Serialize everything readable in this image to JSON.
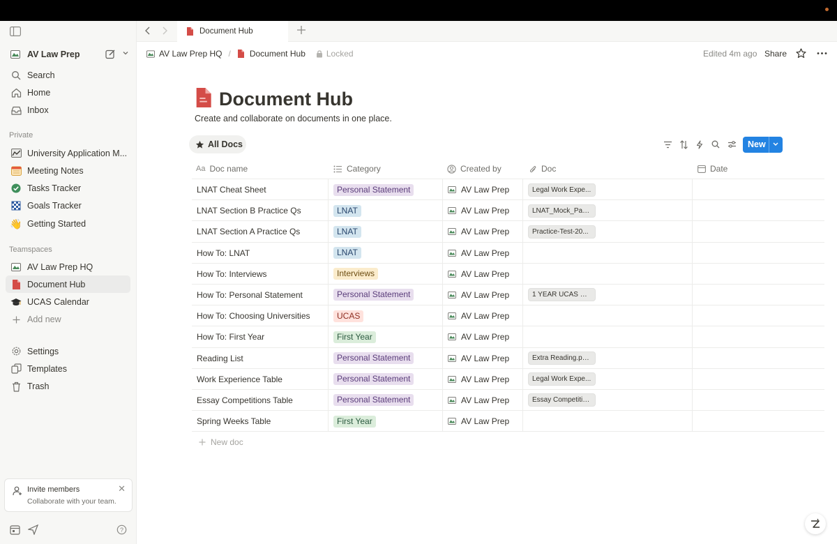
{
  "colors": {
    "accent": "#2383e2",
    "page_icon": "#d44c47",
    "tag_purple_bg": "#e8deee",
    "tag_purple_fg": "#5a3c7a",
    "tag_blue_bg": "#d3e5ef",
    "tag_blue_fg": "#28456c",
    "tag_yellow_bg": "#fbeccc",
    "tag_yellow_fg": "#6e4e14",
    "tag_red_bg": "#ffe2dd",
    "tag_red_fg": "#8e2f23",
    "tag_green_bg": "#dbeddb",
    "tag_green_fg": "#2b593f"
  },
  "sidebar": {
    "workspace": "AV Law Prep",
    "top": [
      {
        "label": "Search",
        "icon": "search-icon"
      },
      {
        "label": "Home",
        "icon": "home-icon"
      },
      {
        "label": "Inbox",
        "icon": "inbox-icon"
      }
    ],
    "private_heading": "Private",
    "private": [
      {
        "label": "University Application M...",
        "icon": "chart-icon"
      },
      {
        "label": "Meeting Notes",
        "icon": "calendar-icon"
      },
      {
        "label": "Tasks Tracker",
        "icon": "check-circle-icon"
      },
      {
        "label": "Goals Tracker",
        "icon": "checkered-flag-icon"
      },
      {
        "label": "Getting Started",
        "icon": "waving-hand-icon"
      }
    ],
    "teamspaces_heading": "Teamspaces",
    "teamspaces": [
      {
        "label": "AV Law Prep HQ",
        "icon": "map-icon"
      },
      {
        "label": "Document Hub",
        "icon": "document-icon"
      },
      {
        "label": "UCAS Calendar",
        "icon": "graduation-cap-icon"
      },
      {
        "label": "Add new",
        "icon": "plus-icon"
      }
    ],
    "bottom": [
      {
        "label": "Settings",
        "icon": "gear-icon"
      },
      {
        "label": "Templates",
        "icon": "templates-icon"
      },
      {
        "label": "Trash",
        "icon": "trash-icon"
      }
    ],
    "invite": {
      "title": "Invite members",
      "subtitle": "Collaborate with your team."
    }
  },
  "tabbar": {
    "tab_label": "Document Hub"
  },
  "header": {
    "breadcrumb_parent": "AV Law Prep HQ",
    "breadcrumb_sep": "/",
    "breadcrumb_current": "Document Hub",
    "locked": "Locked",
    "edited": "Edited 4m ago",
    "share": "Share"
  },
  "page": {
    "title": "Document Hub",
    "description": "Create and collaborate on documents in one place.",
    "view_tab": "All Docs",
    "new_button": "New",
    "new_doc": "New doc"
  },
  "table": {
    "columns": [
      {
        "label": "Doc name",
        "icon": "text-icon"
      },
      {
        "label": "Category",
        "icon": "list-icon"
      },
      {
        "label": "Created by",
        "icon": "person-icon"
      },
      {
        "label": "Doc",
        "icon": "paperclip-icon"
      },
      {
        "label": "Date",
        "icon": "calendar-icon"
      }
    ],
    "rows": [
      {
        "name": "LNAT Cheat Sheet",
        "category": "Personal Statement",
        "color": "purple",
        "created_by": "AV Law Prep",
        "doc": "Legal Work Expe..."
      },
      {
        "name": "LNAT Section B Practice Qs",
        "category": "LNAT",
        "color": "blue",
        "created_by": "AV Law Prep",
        "doc": "LNAT_Mock_Pap..."
      },
      {
        "name": "LNAT Section A Practice Qs",
        "category": "LNAT",
        "color": "blue",
        "created_by": "AV Law Prep",
        "doc": "Practice-Test-20..."
      },
      {
        "name": "How To: LNAT",
        "category": "LNAT",
        "color": "blue",
        "created_by": "AV Law Prep",
        "doc": ""
      },
      {
        "name": "How To: Interviews",
        "category": "Interviews",
        "color": "yellow",
        "created_by": "AV Law Prep",
        "doc": ""
      },
      {
        "name": "How To: Personal Statement",
        "category": "Personal Statement",
        "color": "purple",
        "created_by": "AV Law Prep",
        "doc": "1 YEAR UCAS PL..."
      },
      {
        "name": "How To: Choosing Universities",
        "category": "UCAS",
        "color": "red",
        "created_by": "AV Law Prep",
        "doc": ""
      },
      {
        "name": "How To: First Year",
        "category": "First Year",
        "color": "green",
        "created_by": "AV Law Prep",
        "doc": ""
      },
      {
        "name": "Reading List",
        "category": "Personal Statement",
        "color": "purple",
        "created_by": "AV Law Prep",
        "doc": "Extra Reading.pptx"
      },
      {
        "name": "Work Experience Table",
        "category": "Personal Statement",
        "color": "purple",
        "created_by": "AV Law Prep",
        "doc": "Legal Work Expe..."
      },
      {
        "name": "Essay Competitions Table",
        "category": "Personal Statement",
        "color": "purple",
        "created_by": "AV Law Prep",
        "doc": "Essay Competitio..."
      },
      {
        "name": "Spring Weeks Table",
        "category": "First Year",
        "color": "green",
        "created_by": "AV Law Prep",
        "doc": ""
      }
    ]
  }
}
